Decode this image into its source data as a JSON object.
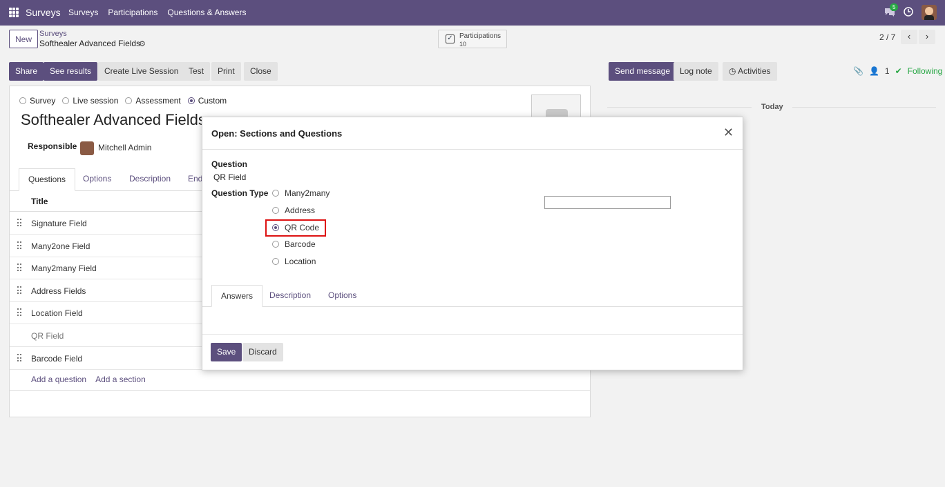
{
  "navbar": {
    "brand": "Surveys",
    "menu": [
      "Surveys",
      "Participations",
      "Questions & Answers"
    ],
    "chat_badge": "5"
  },
  "control": {
    "new_label": "New",
    "breadcrumb_parent": "Surveys",
    "breadcrumb_current": "Softhealer Advanced Fields",
    "stat_label": "Participations",
    "stat_value": "10",
    "pager": "2 / 7"
  },
  "actions": {
    "share": "Share",
    "see_results": "See results",
    "create_live": "Create Live Session",
    "test": "Test",
    "print": "Print",
    "close": "Close",
    "send_message": "Send message",
    "log_note": "Log note",
    "activities": "Activities",
    "attachments_count": "1",
    "following": "Following"
  },
  "form": {
    "survey_types": [
      "Survey",
      "Live session",
      "Assessment",
      "Custom"
    ],
    "selected_type": "Custom",
    "title": "Softhealer Advanced Fields",
    "responsible_label": "Responsible",
    "responsible_name": "Mitchell Admin",
    "tabs": [
      "Questions",
      "Options",
      "Description",
      "End"
    ],
    "column_title": "Title",
    "rows": [
      {
        "title": "Signature Field",
        "section": false
      },
      {
        "title": "Many2one Field",
        "section": false
      },
      {
        "title": "Many2many Field",
        "section": false
      },
      {
        "title": "Address Fields",
        "section": false
      },
      {
        "title": "Location Field",
        "section": false
      },
      {
        "title": "QR Field",
        "section": true
      },
      {
        "title": "Barcode Field",
        "section": false
      }
    ],
    "add_question": "Add a question",
    "add_section": "Add a section"
  },
  "chatter": {
    "today": "Today"
  },
  "dialog": {
    "title": "Open: Sections and Questions",
    "question_label": "Question",
    "question_value": "QR Field",
    "type_label": "Question Type",
    "options": [
      "Many2many",
      "Address",
      "QR Code",
      "Barcode",
      "Location"
    ],
    "selected_option": "QR Code",
    "tabs": [
      "Answers",
      "Description",
      "Options"
    ],
    "save": "Save",
    "discard": "Discard"
  }
}
